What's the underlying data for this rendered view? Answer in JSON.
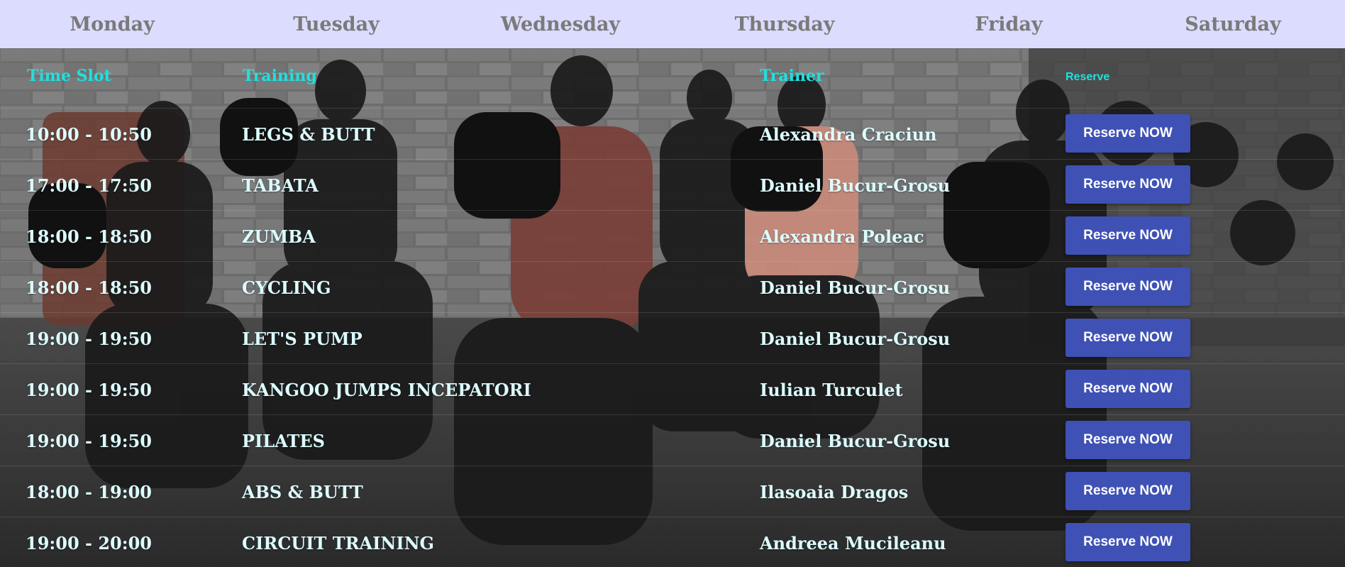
{
  "days": [
    "Monday",
    "Tuesday",
    "Wednesday",
    "Thursday",
    "Friday",
    "Saturday"
  ],
  "table": {
    "headers": {
      "time_slot": "Time Slot",
      "training": "Training",
      "trainer": "Trainer",
      "reserve": "Reserve"
    },
    "button_label": "Reserve NOW",
    "rows": [
      {
        "time": "10:00 - 10:50",
        "training": "LEGS & BUTT",
        "trainer": "Alexandra Craciun"
      },
      {
        "time": "17:00 - 17:50",
        "training": "TABATA",
        "trainer": "Daniel Bucur-Grosu"
      },
      {
        "time": "18:00 - 18:50",
        "training": "ZUMBA",
        "trainer": "Alexandra Poleac"
      },
      {
        "time": "18:00 - 18:50",
        "training": "CYCLING",
        "trainer": "Daniel Bucur-Grosu"
      },
      {
        "time": "19:00 - 19:50",
        "training": "LET'S PUMP",
        "trainer": "Daniel Bucur-Grosu"
      },
      {
        "time": "19:00 - 19:50",
        "training": "KANGOO JUMPS INCEPATORI",
        "trainer": "Iulian Turculet"
      },
      {
        "time": "19:00 - 19:50",
        "training": "PILATES",
        "trainer": "Daniel Bucur-Grosu"
      },
      {
        "time": "18:00 - 19:00",
        "training": "ABS & BUTT",
        "trainer": "Ilasoaia Dragos"
      },
      {
        "time": "19:00 - 20:00",
        "training": "CIRCUIT TRAINING",
        "trainer": "Andreea Mucileanu"
      }
    ]
  },
  "colors": {
    "daybar_bg": "#dcdcff",
    "day_text": "#7a7a7a",
    "header_text": "#1fe0e0",
    "cell_text": "#dcfbff",
    "button_bg": "#3f51b5",
    "button_text": "#ffffff"
  }
}
